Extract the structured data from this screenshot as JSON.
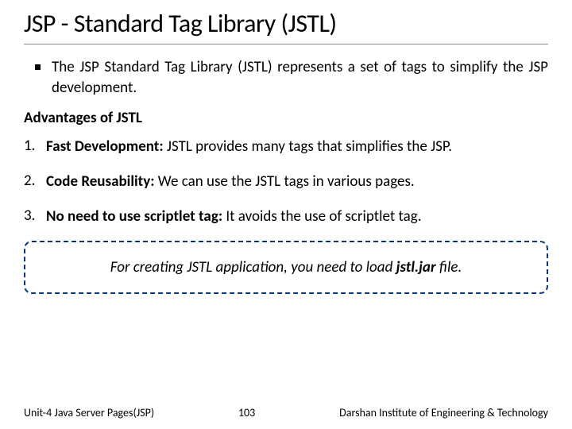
{
  "title": "JSP - Standard Tag Library (JSTL)",
  "intro": "The JSP Standard Tag Library (JSTL) represents a set of tags to simplify the JSP development.",
  "advantages_heading": "Advantages of JSTL",
  "items": [
    {
      "num": "1.",
      "label": "Fast Development:",
      "text": " JSTL provides many tags that simplifies the JSP."
    },
    {
      "num": "2.",
      "label": "Code Reusability:",
      "text": " We can use the JSTL tags in various pages."
    },
    {
      "num": "3.",
      "label": "No need to use scriptlet tag:",
      "text": " It avoids the use of scriptlet tag."
    }
  ],
  "callout": {
    "prefix": "For creating JSTL application, you need to load ",
    "bold": "jstl.jar",
    "suffix": " file."
  },
  "footer": {
    "left": "Unit-4 Java Server Pages(JSP)",
    "center": "103",
    "right": "Darshan Institute of Engineering & Technology"
  }
}
